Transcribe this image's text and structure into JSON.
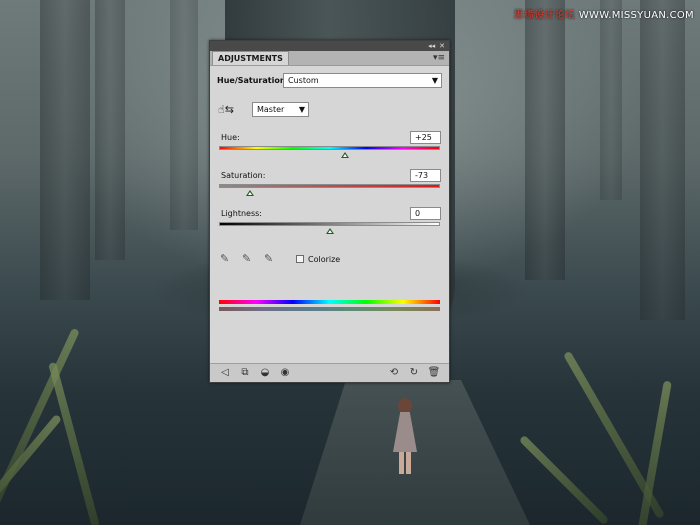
{
  "watermark": {
    "brand": "思缘设计论坛",
    "url": "WWW.MISSYUAN.COM"
  },
  "panel": {
    "tab_label": "ADJUSTMENTS",
    "adjustment_name": "Hue/Saturation",
    "preset_value": "Custom",
    "channel_value": "Master",
    "hue": {
      "label": "Hue:",
      "value": "+25",
      "level": 25,
      "min": -180,
      "max": 180
    },
    "saturation": {
      "label": "Saturation:",
      "value": "-73",
      "level": -73,
      "min": -100,
      "max": 100
    },
    "lightness": {
      "label": "Lightness:",
      "value": "0",
      "level": 0,
      "min": -100,
      "max": 100
    },
    "colorize_label": "Colorize",
    "colorize_checked": false,
    "icons": {
      "titlebar": [
        "collapse-icon",
        "close-icon"
      ],
      "menu": "panel-menu-icon",
      "hand": "targeted-adjustment-icon",
      "eyedroppers": [
        "eyedropper-icon",
        "eyedropper-plus-icon",
        "eyedropper-minus-icon"
      ],
      "bottom_left": [
        "back-arrow-icon",
        "clip-to-layer-icon",
        "mask-icon",
        "visibility-eye-icon"
      ],
      "bottom_right": [
        "view-previous-icon",
        "reset-icon",
        "delete-icon"
      ]
    }
  }
}
